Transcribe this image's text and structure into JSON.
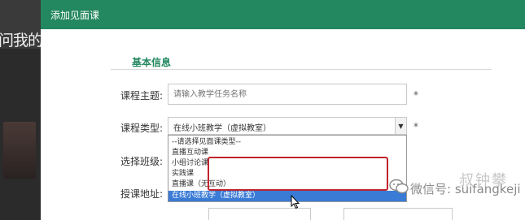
{
  "background": {
    "partial_text": "问我的s"
  },
  "dialog": {
    "title": "添加见面课",
    "section_title": "基本信息",
    "fields": {
      "topic_label": "课程主题:",
      "topic_placeholder": "请输入教学任务名称",
      "type_label": "课程类型:",
      "type_value": "在线小班教学（虚拟教室）",
      "class_label": "选择班级:",
      "address_label": "授课地址:",
      "required_mark": "*"
    },
    "dropdown_options": [
      "--请选择见面课类型--",
      "直播互动课",
      "小组讨论课",
      "实践课",
      "直播课（无互动）",
      "在线小班教学（虚拟教室）"
    ],
    "selected_index": 5,
    "highlight_color": "#c0242d"
  },
  "watermark": {
    "text": "微信号: suifangkeji",
    "faded_text": "叔钟攀"
  },
  "colors": {
    "header": "#23875f",
    "selected_option": "#3a7bd5"
  }
}
